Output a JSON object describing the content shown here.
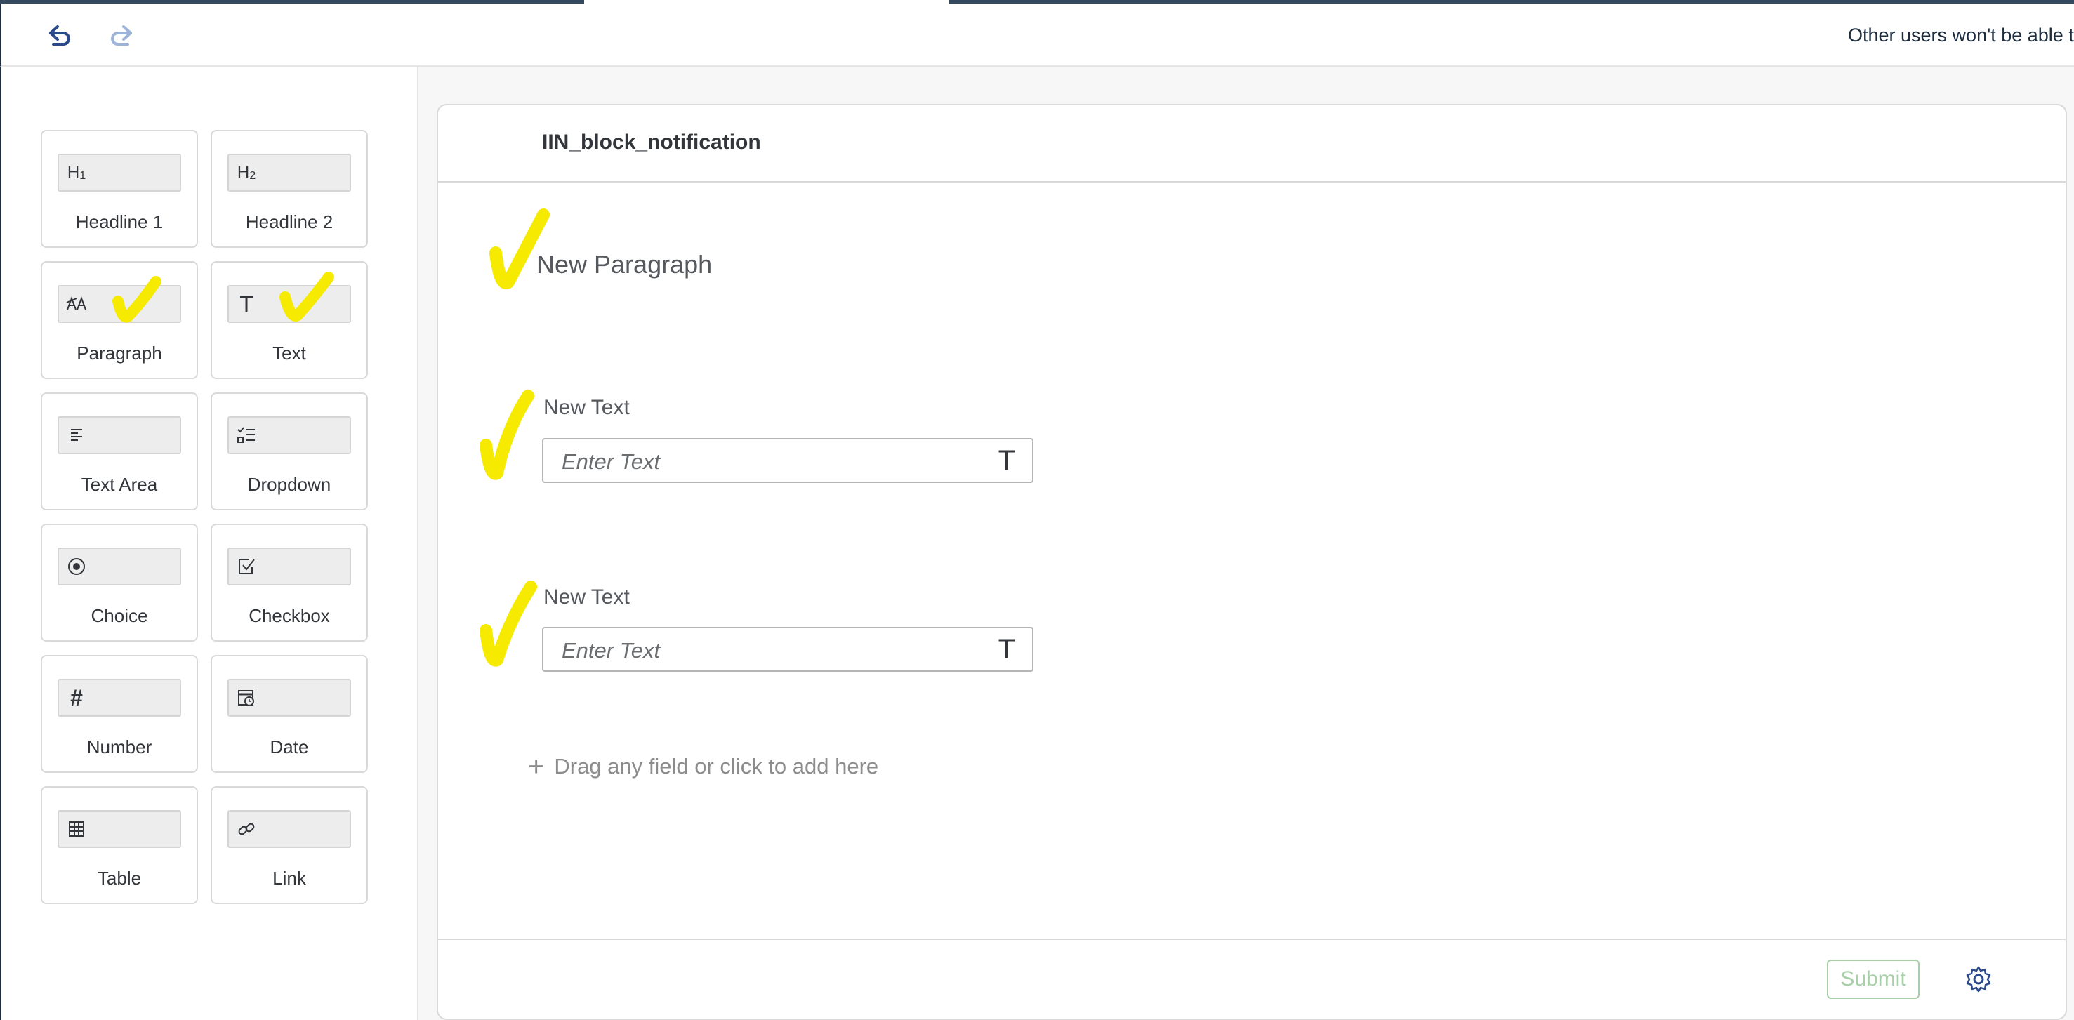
{
  "header": {
    "undo_icon": "undo-icon",
    "redo_icon": "redo-icon",
    "lock_message": "Other users won't be able to"
  },
  "palette": {
    "tiles": [
      {
        "label": "Headline 1",
        "icon": "headline1-icon",
        "glyph": "H₁"
      },
      {
        "label": "Headline 2",
        "icon": "headline2-icon",
        "glyph": "H₂"
      },
      {
        "label": "Paragraph",
        "icon": "paragraph-icon",
        "glyph": "ᴬ"
      },
      {
        "label": "Text",
        "icon": "text-icon",
        "glyph": "T"
      },
      {
        "label": "Text Area",
        "icon": "text-area-icon",
        "glyph": ""
      },
      {
        "label": "Dropdown",
        "icon": "dropdown-icon",
        "glyph": ""
      },
      {
        "label": "Choice",
        "icon": "radio-icon",
        "glyph": ""
      },
      {
        "label": "Checkbox",
        "icon": "checkbox-icon",
        "glyph": ""
      },
      {
        "label": "Number",
        "icon": "number-icon",
        "glyph": "#"
      },
      {
        "label": "Date",
        "icon": "calendar-icon",
        "glyph": ""
      },
      {
        "label": "Table",
        "icon": "table-icon",
        "glyph": ""
      },
      {
        "label": "Link",
        "icon": "link-icon",
        "glyph": ""
      }
    ]
  },
  "form": {
    "title": "IIN_block_notification",
    "paragraph": "New Paragraph",
    "fields": [
      {
        "label": "New Text",
        "placeholder": "Enter Text",
        "type_glyph": "T"
      },
      {
        "label": "New Text",
        "placeholder": "Enter Text",
        "type_glyph": "T"
      }
    ],
    "add_field": "Drag any field or click to add here",
    "submit_label": "Submit",
    "settings_icon": "gear-icon"
  },
  "colors": {
    "brand_dark": "#354a5f",
    "accent_blue": "#0a6ed1",
    "annotation_yellow": "#f5ea00",
    "submit_disabled": "#a8d0a8"
  }
}
